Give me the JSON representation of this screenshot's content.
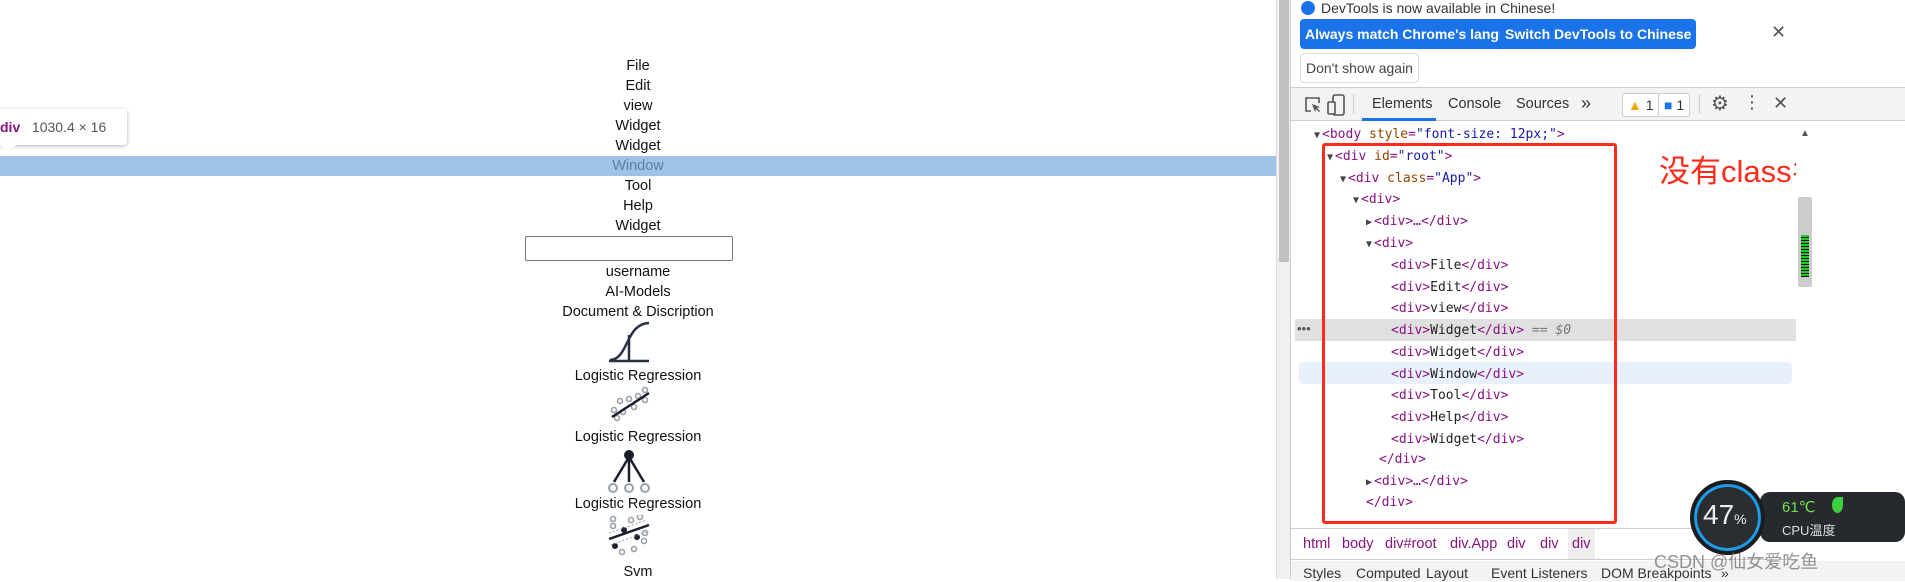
{
  "page": {
    "menu_items": [
      "File",
      "Edit",
      "view",
      "Widget",
      "Widget",
      "Window",
      "Tool",
      "Help",
      "Widget"
    ],
    "input_value": "",
    "labels": [
      "username",
      "AI-Models",
      "Document & Discription"
    ],
    "models": [
      {
        "icon": "sigmoid-icon",
        "label": "Logistic Regression"
      },
      {
        "icon": "linear-regression-icon",
        "label": "Logistic Regression"
      },
      {
        "icon": "decision-tree-icon",
        "label": "Logistic Regression"
      },
      {
        "icon": "svm-icon",
        "label": "Svm"
      }
    ],
    "inspect_tooltip": {
      "tag": "div",
      "size": "1030.4 × 16"
    }
  },
  "devtools": {
    "notice_text": "DevTools is now available in Chinese!",
    "btn_match": "Always match Chrome's language",
    "btn_switch": "Switch DevTools to Chinese",
    "btn_dont": "Don't show again",
    "tabs": [
      "Elements",
      "Console",
      "Sources"
    ],
    "more": "»",
    "warn_count": "1",
    "msg_count": "1",
    "tree": {
      "body": "<body ",
      "body_attr": "style",
      "body_val": "\"font-size: 12px;\"",
      "body_end": ">",
      "root": "<div ",
      "root_attr": "id",
      "root_val": "\"root\"",
      "root_end": ">",
      "app": "<div ",
      "app_attr": "class",
      "app_val": "\"App\"",
      "app_end": ">",
      "div_open": "<div>",
      "collapsed": "<div>…</div>",
      "children": [
        "File",
        "Edit",
        "view",
        "Widget",
        "Widget",
        "Window",
        "Tool",
        "Help",
        "Widget"
      ],
      "div_close": "</div>",
      "selected_suffix": "== $0"
    },
    "annotation": "没有class名",
    "breadcrumbs": [
      "html",
      "body",
      "div#root",
      "div.App",
      "div",
      "div",
      "div"
    ],
    "subtabs": [
      "Styles",
      "Computed",
      "Layout",
      "Event Listeners",
      "DOM Breakpoints",
      "»"
    ]
  },
  "overlay": {
    "cpu_percent": "47",
    "percent_sign": "%",
    "temp": "61℃",
    "temp_label": "CPU温度",
    "watermark": "CSDN @仙女爱吃鱼"
  },
  "colors": {
    "accent": "#1a73e8",
    "highlight": "#9fc3e7",
    "annotation": "#ff2a1a"
  }
}
